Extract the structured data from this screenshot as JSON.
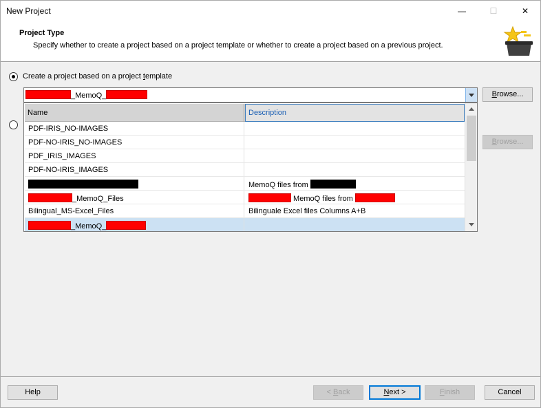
{
  "window": {
    "title": "New Project",
    "minimize_glyph": "—",
    "maximize_glyph": "☐",
    "close_glyph": "✕"
  },
  "header": {
    "title": "Project Type",
    "description": "Specify whether to create a project based on a project template or whether to create a project based on a previous project.",
    "icon": "star-basket-icon"
  },
  "options": {
    "template": {
      "label_pre": "Create a project based on a project ",
      "label_underlined": "t",
      "label_post": "emplate",
      "selected": true
    },
    "previous": {
      "selected": false
    }
  },
  "combo": {
    "value_middle": "_MemoQ_"
  },
  "browse1": {
    "label_underlined": "B",
    "label_post": "rowse..."
  },
  "browse2": {
    "label_underlined": "B",
    "label_post": "rowse..."
  },
  "grid": {
    "columns": {
      "name": "Name",
      "description": "Description"
    },
    "rows": [
      {
        "name": "PDF-IRIS_NO-IMAGES",
        "description": ""
      },
      {
        "name": "PDF-NO-IRIS_NO-IMAGES",
        "description": ""
      },
      {
        "name": "PDF_IRIS_IMAGES",
        "description": ""
      },
      {
        "name": "PDF-NO-IRIS_IMAGES",
        "description": ""
      },
      {
        "name": "",
        "description": "MemoQ files from "
      },
      {
        "name": "_MemoQ_Files",
        "description": " MemoQ files from "
      },
      {
        "name": "Bilingual_MS-Excel_Files",
        "description": "Bilinguale Excel files Columns A+B"
      },
      {
        "name": "_MemoQ_",
        "description": ""
      }
    ]
  },
  "footer": {
    "help": "Help",
    "back_underlined": "B",
    "back_pre": "< ",
    "back_post": "ack",
    "next_underlined": "N",
    "next_post": "ext >",
    "finish_underlined": "F",
    "finish_post": "inish",
    "cancel": "Cancel"
  },
  "colors": {
    "accent": "#0078d7",
    "redaction_red": "#ff0000",
    "redaction_black": "#000000",
    "selected_row": "#cce1f3"
  }
}
